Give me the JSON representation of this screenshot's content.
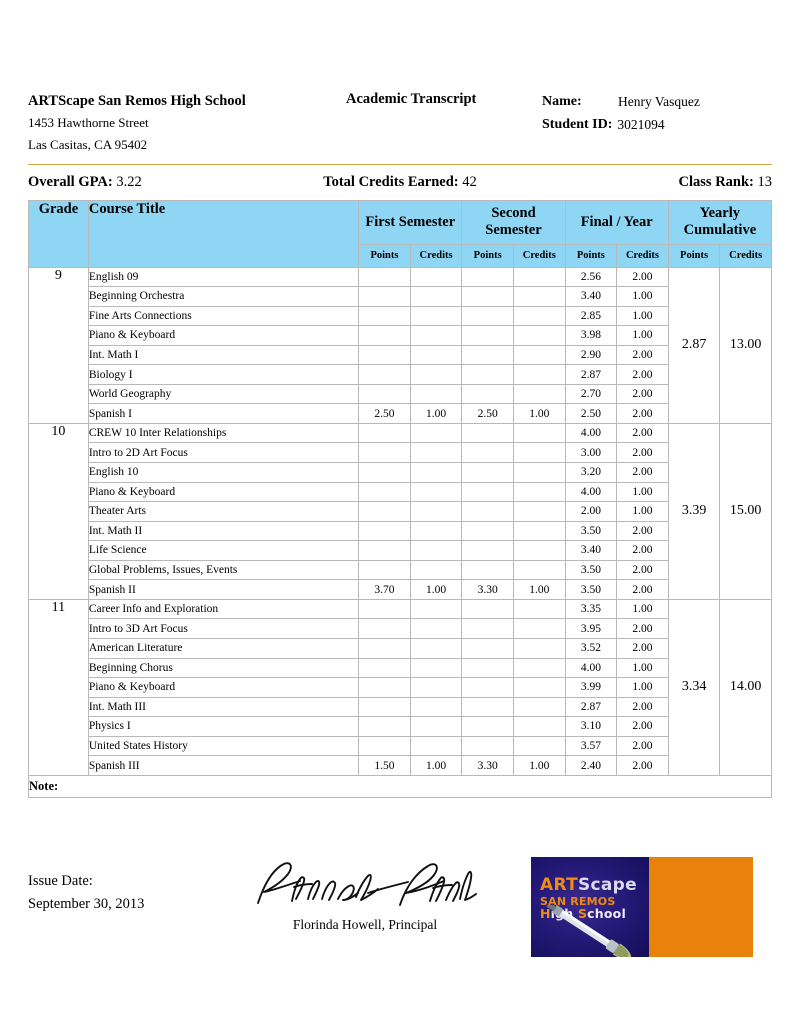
{
  "header": {
    "school_name": "ARTScape San Remos High School",
    "address_line1": "1453 Hawthorne Street",
    "address_line2": "Las Casitas, CA 95402",
    "document_title": "Academic Transcript",
    "name_label": "Name:",
    "name_value": "Henry Vasquez",
    "student_id_label": "Student ID:",
    "student_id_value": "3021094",
    "rule_color": "#d4a843"
  },
  "summary": {
    "gpa_label": "Overall GPA:",
    "gpa_value": "3.22",
    "credits_label": "Total Credits Earned:",
    "credits_value": "42",
    "rank_label": "Class Rank:",
    "rank_value": "13"
  },
  "table": {
    "header_bg": "#8ed6f3",
    "columns": {
      "grade": "Grade",
      "course": "Course Title",
      "first_semester": "First Semester",
      "second_semester": "Second Semester",
      "final_year": "Final / Year",
      "yearly_cumulative": "Yearly Cumulative",
      "points": "Points",
      "credits": "Credits"
    },
    "grades": [
      {
        "grade": "9",
        "cum_points": "2.87",
        "cum_credits": "13.00",
        "courses": [
          {
            "title": "English 09",
            "s1p": "",
            "s1c": "",
            "s2p": "",
            "s2c": "",
            "fp": "2.56",
            "fc": "2.00"
          },
          {
            "title": "Beginning Orchestra",
            "s1p": "",
            "s1c": "",
            "s2p": "",
            "s2c": "",
            "fp": "3.40",
            "fc": "1.00"
          },
          {
            "title": "Fine Arts Connections",
            "s1p": "",
            "s1c": "",
            "s2p": "",
            "s2c": "",
            "fp": "2.85",
            "fc": "1.00"
          },
          {
            "title": "Piano & Keyboard",
            "s1p": "",
            "s1c": "",
            "s2p": "",
            "s2c": "",
            "fp": "3.98",
            "fc": "1.00"
          },
          {
            "title": "Int. Math I",
            "s1p": "",
            "s1c": "",
            "s2p": "",
            "s2c": "",
            "fp": "2.90",
            "fc": "2.00"
          },
          {
            "title": "Biology I",
            "s1p": "",
            "s1c": "",
            "s2p": "",
            "s2c": "",
            "fp": "2.87",
            "fc": "2.00"
          },
          {
            "title": "World Geography",
            "s1p": "",
            "s1c": "",
            "s2p": "",
            "s2c": "",
            "fp": "2.70",
            "fc": "2.00"
          },
          {
            "title": "Spanish I",
            "s1p": "2.50",
            "s1c": "1.00",
            "s2p": "2.50",
            "s2c": "1.00",
            "fp": "2.50",
            "fc": "2.00"
          }
        ]
      },
      {
        "grade": "10",
        "cum_points": "3.39",
        "cum_credits": "15.00",
        "courses": [
          {
            "title": "CREW 10 Inter Relationships",
            "s1p": "",
            "s1c": "",
            "s2p": "",
            "s2c": "",
            "fp": "4.00",
            "fc": "2.00"
          },
          {
            "title": "Intro to 2D Art Focus",
            "s1p": "",
            "s1c": "",
            "s2p": "",
            "s2c": "",
            "fp": "3.00",
            "fc": "2.00"
          },
          {
            "title": "English 10",
            "s1p": "",
            "s1c": "",
            "s2p": "",
            "s2c": "",
            "fp": "3.20",
            "fc": "2.00"
          },
          {
            "title": "Piano & Keyboard",
            "s1p": "",
            "s1c": "",
            "s2p": "",
            "s2c": "",
            "fp": "4.00",
            "fc": "1.00"
          },
          {
            "title": "Theater Arts",
            "s1p": "",
            "s1c": "",
            "s2p": "",
            "s2c": "",
            "fp": "2.00",
            "fc": "1.00"
          },
          {
            "title": "Int. Math II",
            "s1p": "",
            "s1c": "",
            "s2p": "",
            "s2c": "",
            "fp": "3.50",
            "fc": "2.00"
          },
          {
            "title": "Life Science",
            "s1p": "",
            "s1c": "",
            "s2p": "",
            "s2c": "",
            "fp": "3.40",
            "fc": "2.00"
          },
          {
            "title": "Global Problems, Issues, Events",
            "s1p": "",
            "s1c": "",
            "s2p": "",
            "s2c": "",
            "fp": "3.50",
            "fc": "2.00"
          },
          {
            "title": "Spanish II",
            "s1p": "3.70",
            "s1c": "1.00",
            "s2p": "3.30",
            "s2c": "1.00",
            "fp": "3.50",
            "fc": "2.00"
          }
        ]
      },
      {
        "grade": "11",
        "cum_points": "3.34",
        "cum_credits": "14.00",
        "courses": [
          {
            "title": "Career Info and Exploration",
            "s1p": "",
            "s1c": "",
            "s2p": "",
            "s2c": "",
            "fp": "3.35",
            "fc": "1.00"
          },
          {
            "title": "Intro to 3D Art Focus",
            "s1p": "",
            "s1c": "",
            "s2p": "",
            "s2c": "",
            "fp": "3.95",
            "fc": "2.00"
          },
          {
            "title": "American Literature",
            "s1p": "",
            "s1c": "",
            "s2p": "",
            "s2c": "",
            "fp": "3.52",
            "fc": "2.00"
          },
          {
            "title": "Beginning Chorus",
            "s1p": "",
            "s1c": "",
            "s2p": "",
            "s2c": "",
            "fp": "4.00",
            "fc": "1.00"
          },
          {
            "title": "Piano & Keyboard",
            "s1p": "",
            "s1c": "",
            "s2p": "",
            "s2c": "",
            "fp": "3.99",
            "fc": "1.00"
          },
          {
            "title": "Int. Math III",
            "s1p": "",
            "s1c": "",
            "s2p": "",
            "s2c": "",
            "fp": "2.87",
            "fc": "2.00"
          },
          {
            "title": "Physics I",
            "s1p": "",
            "s1c": "",
            "s2p": "",
            "s2c": "",
            "fp": "3.10",
            "fc": "2.00"
          },
          {
            "title": "United States History",
            "s1p": "",
            "s1c": "",
            "s2p": "",
            "s2c": "",
            "fp": "3.57",
            "fc": "2.00"
          },
          {
            "title": "Spanish III",
            "s1p": "1.50",
            "s1c": "1.00",
            "s2p": "3.30",
            "s2c": "1.00",
            "fp": "2.40",
            "fc": "2.00"
          }
        ]
      }
    ],
    "note_label": "Note:",
    "note_value": ""
  },
  "footer": {
    "issue_date_label": "Issue Date:",
    "issue_date_value": "September 30, 2013",
    "signature_name": "Florinda Howell, Principal",
    "signature_script": "Florinda Howell",
    "logo": {
      "line1_a": "ART",
      "line1_b": "Scape",
      "line2": "SAN REMOS",
      "line3_a": "H",
      "line3_b": "igh ",
      "line3_c": "S",
      "line3_d": "chool",
      "accent_color": "#e8820c",
      "panel_color": "#241a78"
    }
  }
}
